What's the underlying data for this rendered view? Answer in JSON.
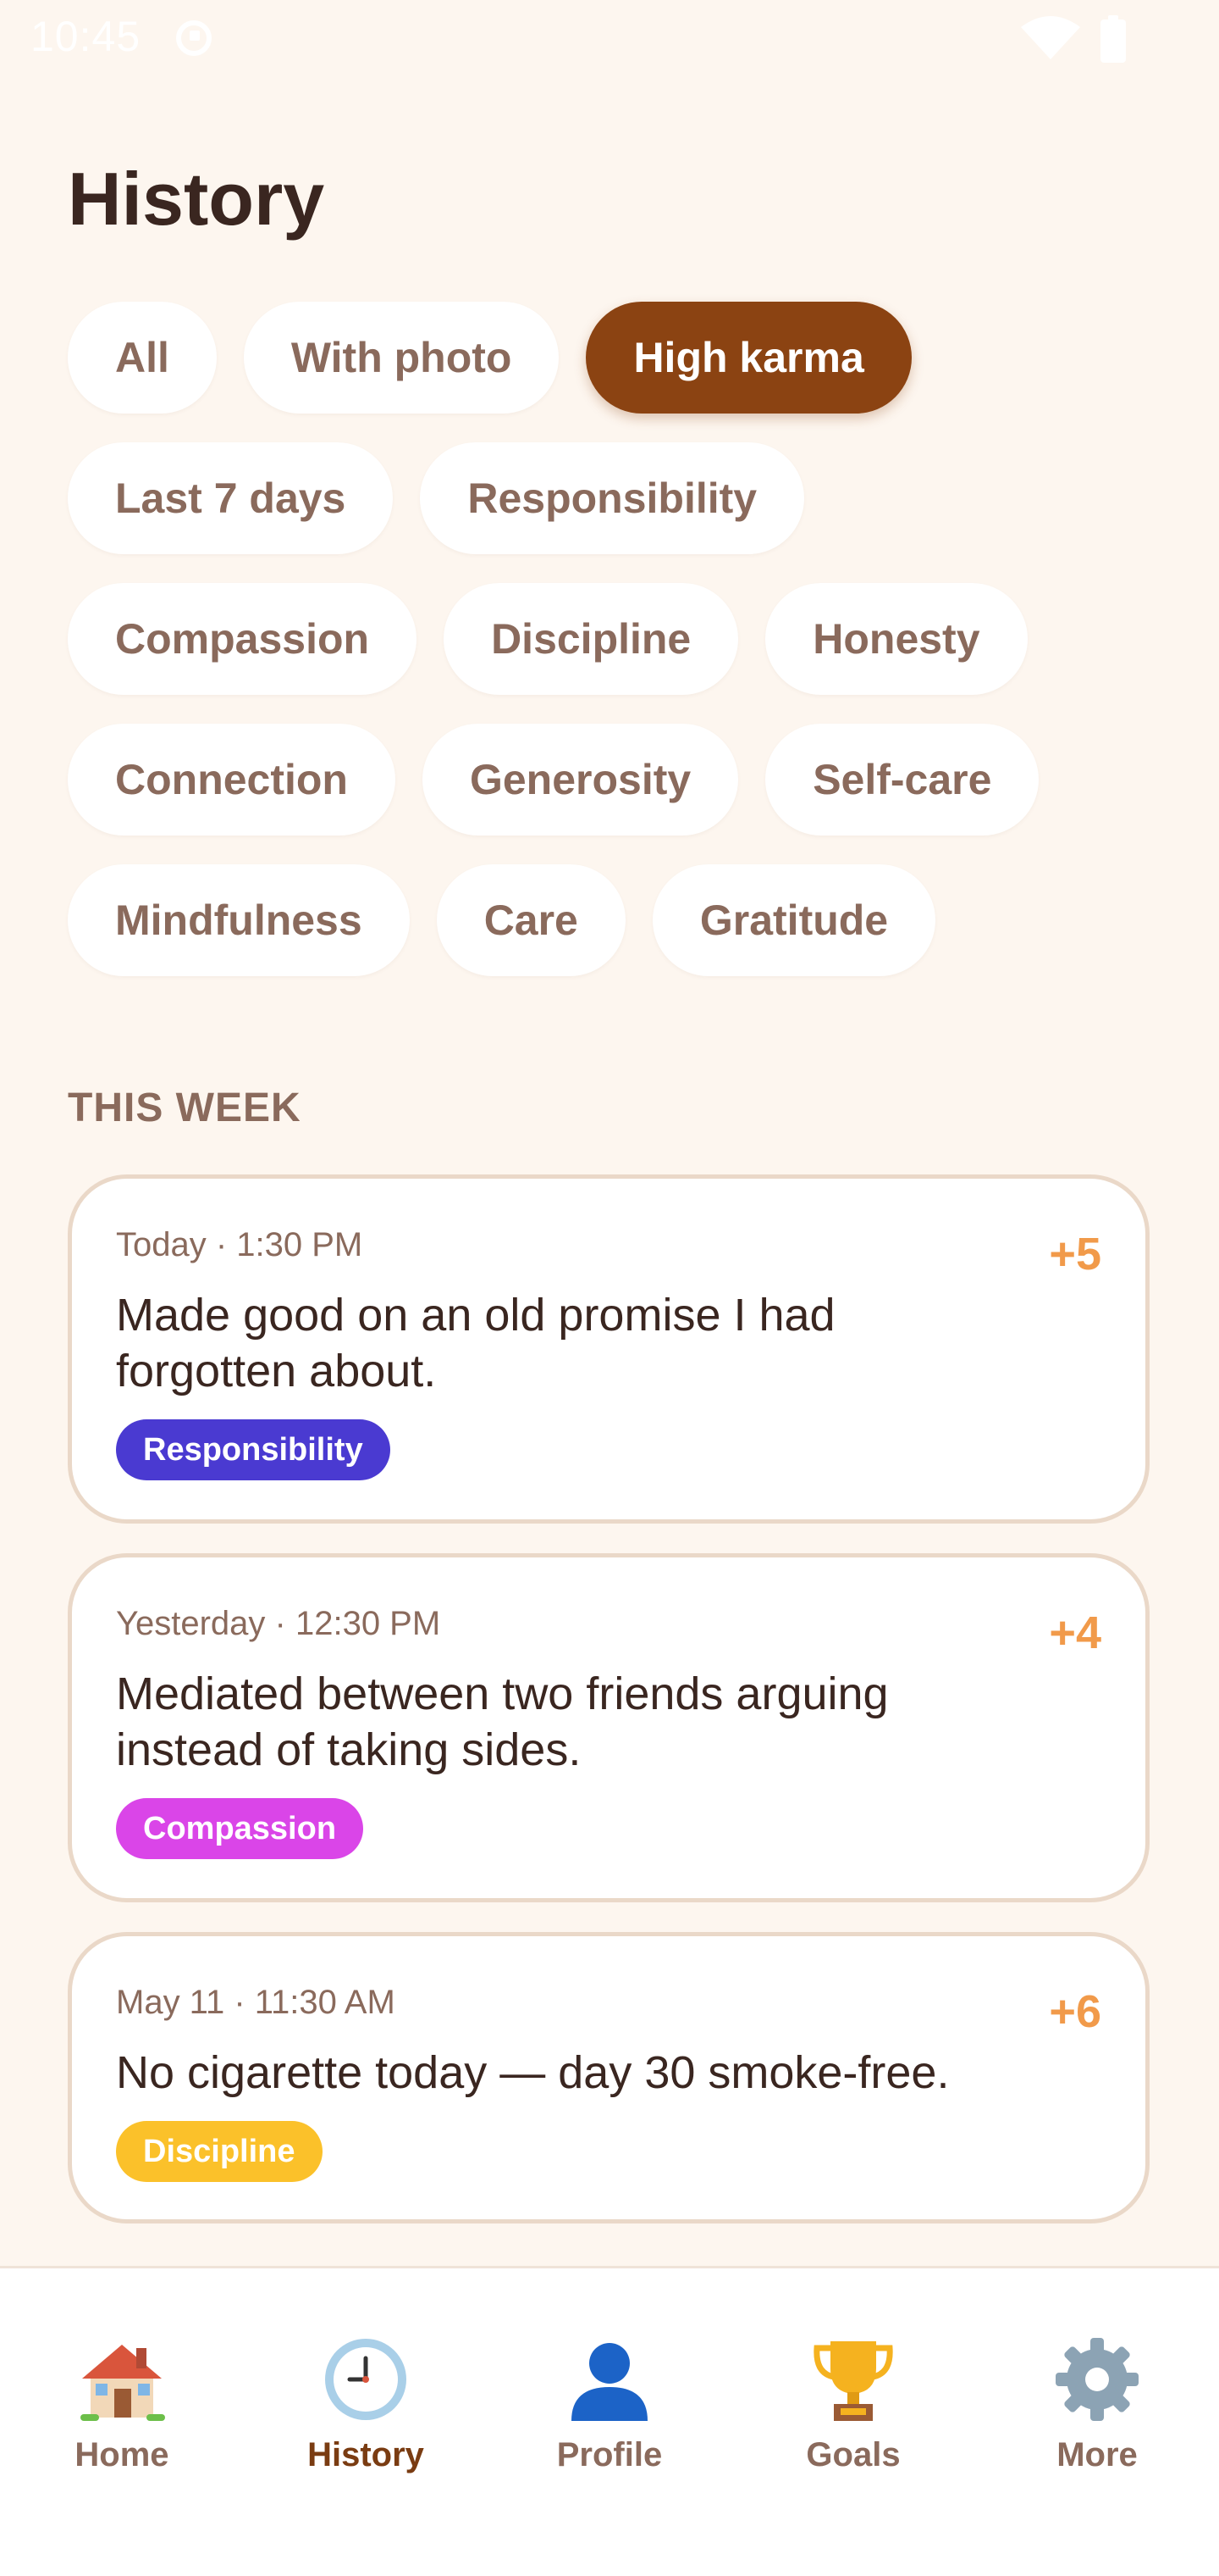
{
  "status_bar": {
    "time": "10:45"
  },
  "page": {
    "title": "History"
  },
  "filters": {
    "rows": [
      [
        {
          "label": "All",
          "active": false
        },
        {
          "label": "With photo",
          "active": false
        },
        {
          "label": "High karma",
          "active": true
        }
      ],
      [
        {
          "label": "Last 7 days",
          "active": false
        },
        {
          "label": "Responsibility",
          "active": false
        }
      ],
      [
        {
          "label": "Compassion",
          "active": false
        },
        {
          "label": "Discipline",
          "active": false
        },
        {
          "label": "Honesty",
          "active": false
        }
      ],
      [
        {
          "label": "Connection",
          "active": false
        },
        {
          "label": "Generosity",
          "active": false
        },
        {
          "label": "Self-care",
          "active": false
        }
      ],
      [
        {
          "label": "Mindfulness",
          "active": false
        },
        {
          "label": "Care",
          "active": false
        },
        {
          "label": "Gratitude",
          "active": false
        }
      ]
    ]
  },
  "section": {
    "title": "THIS WEEK"
  },
  "entries": [
    {
      "time": "Today · 1:30 PM",
      "score": "+5",
      "text": "Made good on an old promise I had forgotten about.",
      "tag": "Responsibility",
      "tag_color": "#4a3ad1"
    },
    {
      "time": "Yesterday · 12:30 PM",
      "score": "+4",
      "text": "Mediated between two friends arguing instead of taking sides.",
      "tag": "Compassion",
      "tag_color": "#da45e8"
    },
    {
      "time": "May 11 · 11:30 AM",
      "score": "+6",
      "text": "No cigarette today — day 30 smoke-free.",
      "tag": "Discipline",
      "tag_color": "#fbc12a"
    }
  ],
  "nav": {
    "items": [
      {
        "label": "Home",
        "icon": "house-icon",
        "active": false
      },
      {
        "label": "History",
        "icon": "clock-icon",
        "active": true
      },
      {
        "label": "Profile",
        "icon": "person-icon",
        "active": false
      },
      {
        "label": "Goals",
        "icon": "trophy-icon",
        "active": false
      },
      {
        "label": "More",
        "icon": "gear-icon",
        "active": false
      }
    ]
  },
  "colors": {
    "background": "#fdf6ef",
    "accent": "#8b4312",
    "score": "#f19a4a",
    "muted_text": "#8a6a5c"
  }
}
